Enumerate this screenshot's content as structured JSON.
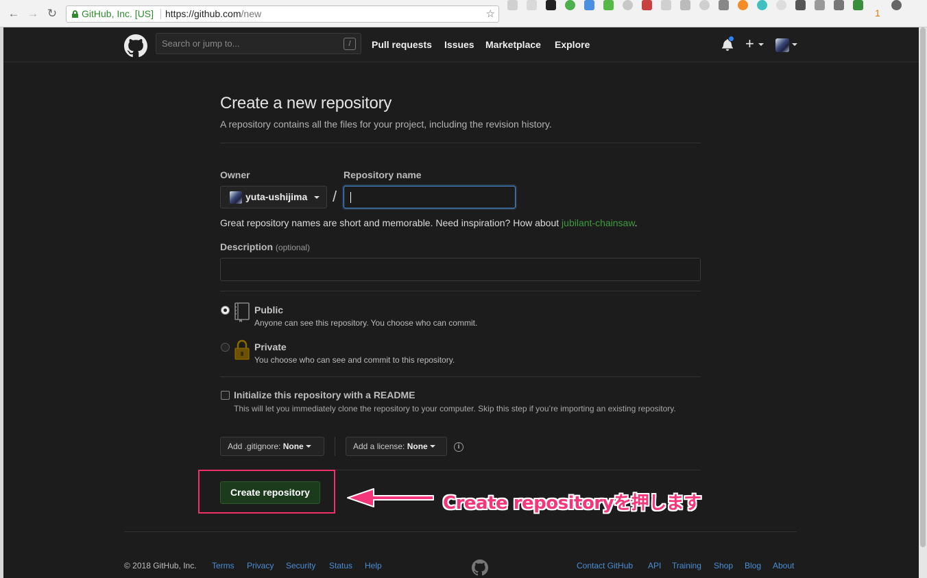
{
  "browser": {
    "secure_label": "GitHub, Inc. [US]",
    "url_host": "https://github.com",
    "url_path": "/new",
    "extension_badge": "1"
  },
  "header": {
    "search_placeholder": "Search or jump to...",
    "search_shortcut": "/",
    "nav": [
      "Pull requests",
      "Issues",
      "Marketplace",
      "Explore"
    ],
    "plus": "+"
  },
  "page": {
    "title": "Create a new repository",
    "subtitle": "A repository contains all the files for your project, including the revision history.",
    "owner_label": "Owner",
    "owner_value": "yuta-ushijima",
    "slash": "/",
    "repo_name_label": "Repository name",
    "repo_name_value": "",
    "hint_text": "Great repository names are short and memorable. Need inspiration? How about ",
    "hint_suggestion": "jubilant-chainsaw",
    "hint_end": ".",
    "description_label": "Description",
    "description_optional": "(optional)",
    "description_value": "",
    "visibility": [
      {
        "title": "Public",
        "desc": "Anyone can see this repository. You choose who can commit.",
        "selected": true
      },
      {
        "title": "Private",
        "desc": "You choose who can see and commit to this repository.",
        "selected": false
      }
    ],
    "readme_title": "Initialize this repository with a README",
    "readme_desc": "This will let you immediately clone the repository to your computer. Skip this step if you’re importing an existing repository.",
    "gitignore_label": "Add .gitignore:",
    "gitignore_value": "None",
    "license_label": "Add a license:",
    "license_value": "None",
    "info": "i",
    "create_button": "Create repository"
  },
  "annotation": {
    "text": "Create repositoryを押します",
    "color": "#f6367a"
  },
  "footer": {
    "copyright": "© 2018 GitHub, Inc.",
    "left_links": [
      "Terms",
      "Privacy",
      "Security",
      "Status",
      "Help"
    ],
    "right_links": [
      "Contact GitHub",
      "API",
      "Training",
      "Shop",
      "Blog",
      "About"
    ]
  }
}
